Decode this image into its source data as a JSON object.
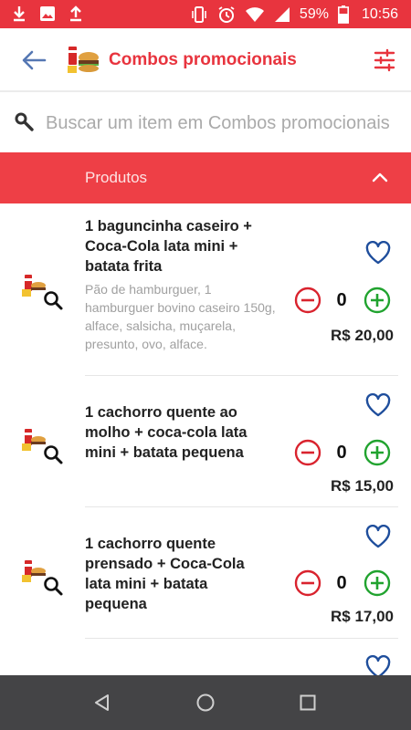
{
  "status_bar": {
    "battery": "59%",
    "time": "10:56"
  },
  "header": {
    "title": "Combos promocionais"
  },
  "search": {
    "placeholder": "Buscar um item em Combos promocionais"
  },
  "section": {
    "label": "Produtos"
  },
  "items": [
    {
      "name": "1 baguncinha caseiro + Coca-Cola lata mini + batata frita",
      "description": "Pão de hamburguer, 1 hamburguer bovino caseiro 150g, alface, salsicha, muçarela, presunto, ovo, alface.",
      "quantity": "0",
      "price": "R$ 20,00"
    },
    {
      "name": "1 cachorro quente ao molho + coca-cola lata mini + batata pequena",
      "description": "",
      "quantity": "0",
      "price": "R$ 15,00"
    },
    {
      "name": "1 cachorro quente prensado + Coca-Cola lata mini + batata pequena",
      "description": "",
      "quantity": "0",
      "price": "R$ 17,00"
    }
  ],
  "colors": {
    "brand_red": "#e8343e",
    "minus_red": "#d9232e",
    "plus_green": "#21a32f",
    "heart_blue": "#1f4e9c",
    "nav_bar": "#444446"
  },
  "icons": {
    "back": "arrow-left-icon",
    "filter": "sliders-icon",
    "search": "search-icon",
    "collapse": "chevron-up-icon",
    "favorite": "heart-outline-icon",
    "decrement": "minus-circle-icon",
    "increment": "plus-circle-icon"
  }
}
